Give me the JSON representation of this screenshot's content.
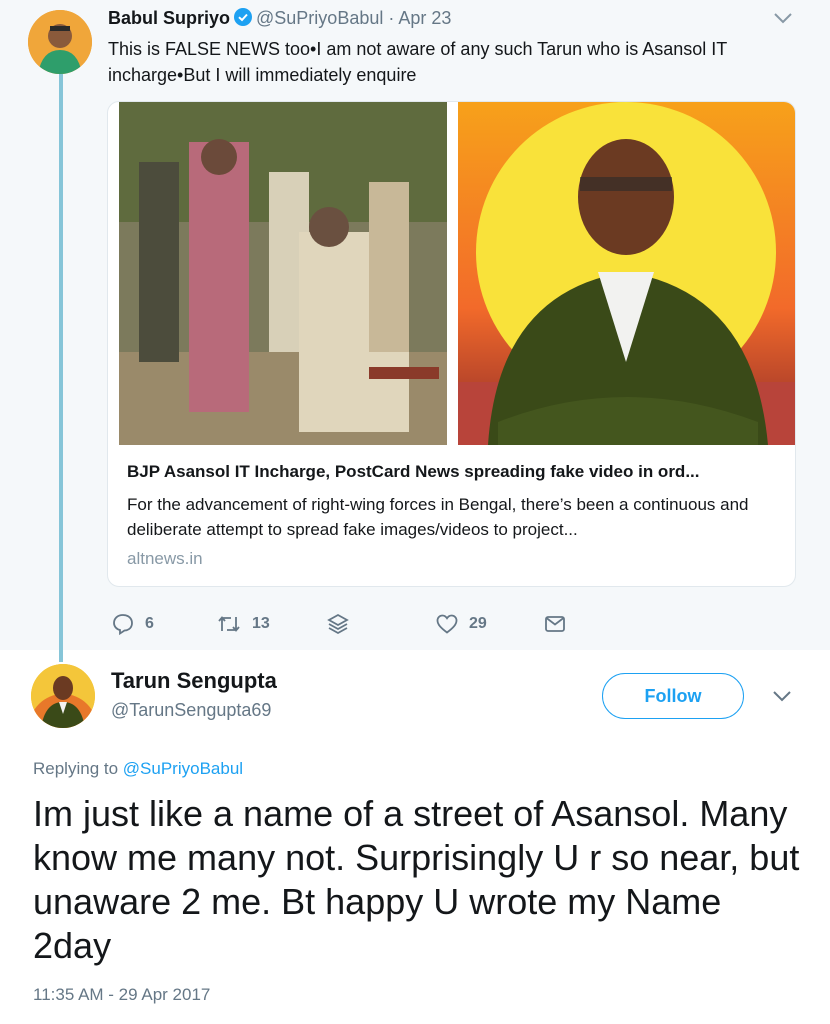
{
  "parent_tweet": {
    "author_name": "Babul Supriyo",
    "author_handle": "@SuPriyoBabul",
    "separator": "·",
    "date": "Apr 23",
    "text": "This is FALSE NEWS too•I am not aware of any such Tarun who is Asansol IT incharge•But I will immediately enquire",
    "card": {
      "title": "BJP Asansol IT Incharge, PostCard News spreading fake video in ord...",
      "description": "For the advancement of right-wing forces in Bengal, there’s been a continuous and deliberate attempt to spread fake images/videos to project...",
      "domain": "altnews.in"
    },
    "actions": {
      "replies": "6",
      "retweets": "13",
      "likes": "29"
    }
  },
  "reply_tweet": {
    "author_name": "Tarun Sengupta",
    "author_handle": "@TarunSengupta69",
    "follow_label": "Follow",
    "replying_prefix": "Replying to",
    "replying_to": "@SuPriyoBabul",
    "text": "Im just like a name of a street of Asansol. Many know me many not. Surprisingly U r so near, but unaware 2 me. Bt happy U wrote my Name 2day",
    "timestamp": "11:35 AM - 29 Apr 2017"
  },
  "icons": {
    "reply": "reply-icon",
    "retweet": "retweet-icon",
    "stack": "layers-icon",
    "like": "heart-icon",
    "message": "envelope-icon",
    "caret": "chevron-down-icon",
    "verified": "verified-badge-icon"
  },
  "colors": {
    "accent": "#1da1f2",
    "secondary_text": "#657786",
    "thread_line": "#86c5d8",
    "parent_background": "#f5f8fa"
  }
}
